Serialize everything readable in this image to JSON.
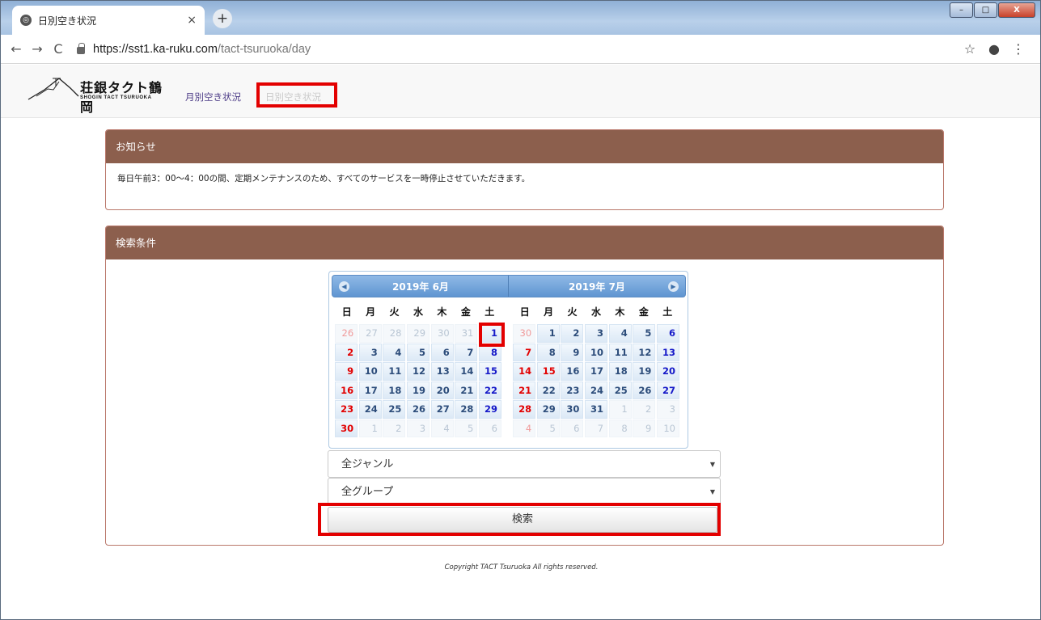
{
  "browser": {
    "tab_title": "日別空き状況",
    "tab_close": "×",
    "new_tab": "+",
    "win_min": "–",
    "win_max": "□",
    "win_close": "X",
    "url_host": "https://sst1.ka-ruku.com",
    "url_path": "/tact-tsuruoka/day",
    "nav_back": "←",
    "nav_forward": "→",
    "nav_reload": "C",
    "star": "☆",
    "account": "●",
    "menu": "⋮"
  },
  "site": {
    "logo_text": "荘銀タクト鶴岡",
    "logo_sub": "SHOGIN TACT TSURUOKA",
    "nav": {
      "month": "月別空き状況",
      "day": "日別空き状況"
    }
  },
  "notice": {
    "title": "お知らせ",
    "body": "毎日午前3：00～4：00の間、定期メンテナンスのため、すべてのサービスを一時停止させていただきます。"
  },
  "search": {
    "title": "検索条件",
    "genre_value": "全ジャンル",
    "group_value": "全グループ",
    "button": "検索"
  },
  "calendar": {
    "prev": "◀",
    "next": "▶",
    "dow": [
      "日",
      "月",
      "火",
      "水",
      "木",
      "金",
      "土"
    ],
    "months": [
      {
        "title": "2019年 6月",
        "days": [
          [
            "26",
            "off"
          ],
          [
            "27",
            "off"
          ],
          [
            "28",
            "off"
          ],
          [
            "29",
            "off"
          ],
          [
            "30",
            "off"
          ],
          [
            "31",
            "off"
          ],
          [
            "1",
            ""
          ],
          [
            "2",
            ""
          ],
          [
            "3",
            ""
          ],
          [
            "4",
            ""
          ],
          [
            "5",
            ""
          ],
          [
            "6",
            ""
          ],
          [
            "7",
            ""
          ],
          [
            "8",
            ""
          ],
          [
            "9",
            ""
          ],
          [
            "10",
            ""
          ],
          [
            "11",
            ""
          ],
          [
            "12",
            ""
          ],
          [
            "13",
            ""
          ],
          [
            "14",
            ""
          ],
          [
            "15",
            ""
          ],
          [
            "16",
            ""
          ],
          [
            "17",
            ""
          ],
          [
            "18",
            ""
          ],
          [
            "19",
            ""
          ],
          [
            "20",
            ""
          ],
          [
            "21",
            ""
          ],
          [
            "22",
            ""
          ],
          [
            "23",
            ""
          ],
          [
            "24",
            ""
          ],
          [
            "25",
            ""
          ],
          [
            "26",
            ""
          ],
          [
            "27",
            ""
          ],
          [
            "28",
            ""
          ],
          [
            "29",
            ""
          ],
          [
            "30",
            ""
          ],
          [
            "1",
            "off"
          ],
          [
            "2",
            "off"
          ],
          [
            "3",
            "off"
          ],
          [
            "4",
            "off"
          ],
          [
            "5",
            "off"
          ],
          [
            "6",
            "off"
          ]
        ]
      },
      {
        "title": "2019年 7月",
        "days": [
          [
            "30",
            "off"
          ],
          [
            "1",
            ""
          ],
          [
            "2",
            ""
          ],
          [
            "3",
            ""
          ],
          [
            "4",
            ""
          ],
          [
            "5",
            ""
          ],
          [
            "6",
            ""
          ],
          [
            "7",
            ""
          ],
          [
            "8",
            ""
          ],
          [
            "9",
            ""
          ],
          [
            "10",
            ""
          ],
          [
            "11",
            ""
          ],
          [
            "12",
            ""
          ],
          [
            "13",
            ""
          ],
          [
            "14",
            ""
          ],
          [
            "15",
            "hol"
          ],
          [
            "16",
            ""
          ],
          [
            "17",
            ""
          ],
          [
            "18",
            ""
          ],
          [
            "19",
            ""
          ],
          [
            "20",
            ""
          ],
          [
            "21",
            ""
          ],
          [
            "22",
            ""
          ],
          [
            "23",
            ""
          ],
          [
            "24",
            ""
          ],
          [
            "25",
            ""
          ],
          [
            "26",
            ""
          ],
          [
            "27",
            ""
          ],
          [
            "28",
            ""
          ],
          [
            "29",
            ""
          ],
          [
            "30",
            ""
          ],
          [
            "31",
            ""
          ],
          [
            "1",
            "off"
          ],
          [
            "2",
            "off"
          ],
          [
            "3",
            "off"
          ],
          [
            "4",
            "off"
          ],
          [
            "5",
            "off"
          ],
          [
            "6",
            "off"
          ],
          [
            "7",
            "off"
          ],
          [
            "8",
            "off"
          ],
          [
            "9",
            "off"
          ],
          [
            "10",
            "off"
          ]
        ]
      }
    ]
  },
  "footer": "Copyright TACT Tsuruoka All rights reserved."
}
